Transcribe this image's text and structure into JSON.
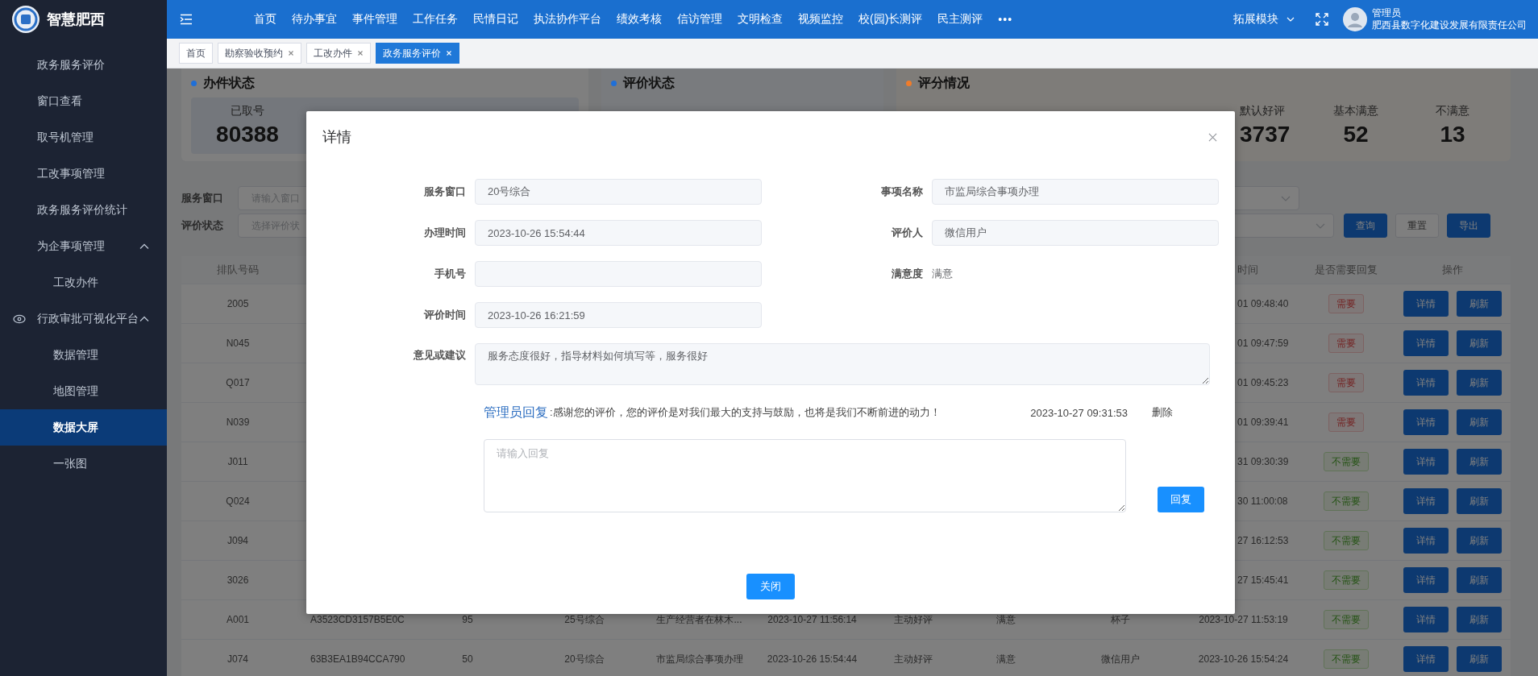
{
  "app": {
    "name": "智慧肥西"
  },
  "top_nav": {
    "items": [
      {
        "label": "首页"
      },
      {
        "label": "待办事宜"
      },
      {
        "label": "事件管理"
      },
      {
        "label": "工作任务"
      },
      {
        "label": "民情日记"
      },
      {
        "label": "执法协作平台"
      },
      {
        "label": "绩效考核"
      },
      {
        "label": "信访管理"
      },
      {
        "label": "文明检查"
      },
      {
        "label": "视频监控"
      },
      {
        "label": "校(园)长测评"
      },
      {
        "label": "民主测评"
      }
    ],
    "more": "•••",
    "module_menu": "拓展模块",
    "user": {
      "name": "管理员",
      "org": "肥西县数字化建设发展有限责任公司"
    }
  },
  "sidebar": {
    "items": [
      {
        "label": "政务服务评价",
        "selected": false
      },
      {
        "label": "窗口查看",
        "selected": false
      },
      {
        "label": "取号机管理",
        "selected": false
      },
      {
        "label": "工改事项管理",
        "selected": false
      },
      {
        "label": "政务服务评价统计",
        "selected": false
      },
      {
        "label": "为企事项管理",
        "selected": false,
        "expanded": true,
        "children": [
          {
            "label": "工改办件",
            "selected": false
          }
        ]
      },
      {
        "label": "行政审批可视化平台",
        "selected": false,
        "expanded": true,
        "icon": true,
        "children": [
          {
            "label": "数据管理",
            "selected": false
          },
          {
            "label": "地图管理",
            "selected": false
          },
          {
            "label": "数据大屏",
            "selected": true
          },
          {
            "label": "一张图",
            "selected": false
          }
        ]
      }
    ]
  },
  "tabs": [
    {
      "label": "首页",
      "closable": false,
      "selected": false
    },
    {
      "label": "勘察验收预约",
      "closable": true,
      "selected": false
    },
    {
      "label": "工改办件",
      "closable": true,
      "selected": false
    },
    {
      "label": "政务服务评价",
      "closable": true,
      "selected": true
    }
  ],
  "stat_cards": [
    {
      "title": "办件状态",
      "color": "#1f6fd8",
      "stats": [
        {
          "label": "已取号",
          "value": "80388"
        }
      ]
    },
    {
      "title": "评价状态",
      "color": "#1f6fd8"
    },
    {
      "title": "评分情况",
      "color": "#f07c2a",
      "stats": [
        {
          "label": "默认好评",
          "value": "3737"
        },
        {
          "label": "基本满意",
          "value": "52"
        },
        {
          "label": "不满意",
          "value": "13"
        }
      ]
    }
  ],
  "filters": [
    {
      "label": "服务窗口",
      "placeholder": "请输入窗口"
    },
    {
      "label": "评价状态",
      "placeholder": "选择评价状"
    }
  ],
  "buttons": [
    {
      "label": "查询",
      "kind": "primary"
    },
    {
      "label": "重置",
      "kind": "default"
    },
    {
      "label": "导出",
      "kind": "primary"
    }
  ],
  "table": {
    "header": {
      "column_1": "排队号码",
      "column_10": "时间",
      "column_11": "是否需要回复",
      "column_12": "操作"
    },
    "rows": [
      {
        "column_1": "2005",
        "column_10": "01 09:48:40",
        "column_11": {
          "text": "需要",
          "kind": "need"
        },
        "column_12": [
          "详情",
          "刷新"
        ]
      },
      {
        "column_1": "N045",
        "column_10": "01 09:47:59",
        "column_11": {
          "text": "需要",
          "kind": "need"
        },
        "column_12": [
          "详情",
          "刷新"
        ]
      },
      {
        "column_1": "Q017",
        "column_10": "01 09:45:23",
        "column_11": {
          "text": "需要",
          "kind": "need"
        },
        "column_12": [
          "详情",
          "刷新"
        ]
      },
      {
        "column_1": "N039",
        "column_10": "01 09:39:41",
        "column_11": {
          "text": "需要",
          "kind": "need"
        },
        "column_12": [
          "详情",
          "刷新"
        ]
      },
      {
        "column_1": "J011",
        "column_10": "31 09:30:39",
        "column_11": {
          "text": "不需要",
          "kind": "no_need"
        },
        "column_12": [
          "详情",
          "刷新"
        ]
      },
      {
        "column_1": "Q024",
        "column_10": "30 11:00:08",
        "column_11": {
          "text": "不需要",
          "kind": "no_need"
        },
        "column_12": [
          "详情",
          "刷新"
        ]
      },
      {
        "column_1": "J094",
        "column_10": "27 16:12:53",
        "column_11": {
          "text": "不需要",
          "kind": "no_need"
        },
        "column_12": [
          "详情",
          "刷新"
        ]
      },
      {
        "column_1": "3026",
        "column_10": "27 15:45:41",
        "column_11": {
          "text": "不需要",
          "kind": "no_need"
        },
        "column_12": [
          "详情",
          "刷新"
        ]
      },
      {
        "column_1": "A001",
        "column_2": "A3523CD3157B5E0C",
        "column_3": "95",
        "column_4": "25号综合",
        "column_5": "生产经营者在林木...",
        "column_6": "2023-10-27 11:56:14",
        "column_7": "主动好评",
        "column_8": "满意",
        "column_9": "杯子",
        "column_10": "2023-10-27 11:53:19",
        "column_11": {
          "text": "不需要",
          "kind": "no_need"
        },
        "column_12": [
          "详情",
          "刷新"
        ]
      },
      {
        "column_1": "J074",
        "column_2": "63B3EA1B94CCA790",
        "column_3": "50",
        "column_4": "20号综合",
        "column_5": "市监局综合事项办理",
        "column_6": "2023-10-26 15:54:44",
        "column_7": "主动好评",
        "column_8": "满意",
        "column_9": "微信用户",
        "column_10": "2023-10-26 15:54:24",
        "column_11": {
          "text": "不需要",
          "kind": "no_need"
        },
        "column_12": [
          "详情",
          "刷新"
        ]
      }
    ]
  },
  "dialog": {
    "title": "详情",
    "fields": [
      {
        "label": "服务窗口",
        "value": "20号综合",
        "kind": "input"
      },
      {
        "label": "事项名称",
        "value": "市监局综合事项办理",
        "kind": "input"
      },
      {
        "label": "办理时间",
        "value": "2023-10-26 15:54:44",
        "kind": "input"
      },
      {
        "label": "评价人",
        "value": "微信用户",
        "kind": "input"
      },
      {
        "label": "手机号",
        "kind": "input"
      },
      {
        "label": "满意度",
        "value": "满意",
        "kind": "text"
      },
      {
        "label": "评价时间",
        "value": "2023-10-26 16:21:59",
        "kind": "input"
      }
    ],
    "suggestion": {
      "label": "意见或建议",
      "value": "服务态度很好，指导材料如何填写等，服务很好"
    },
    "reply": {
      "author": "管理员回复",
      "text": ":感谢您的评价，您的评价是对我们最大的支持与鼓励，也将是我们不断前进的动力！",
      "time": "2023-10-27 09:31:53",
      "delete": "删除"
    },
    "reply_box": {
      "placeholder": "请输入回复",
      "submit": "回复"
    },
    "close": "关闭"
  }
}
